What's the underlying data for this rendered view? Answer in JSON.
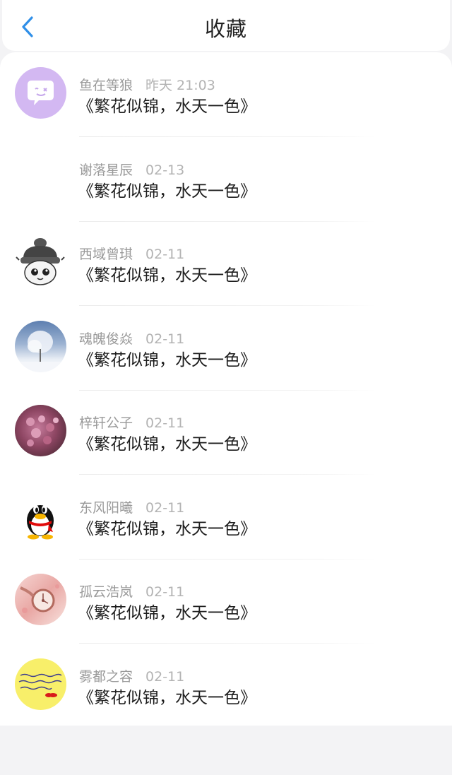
{
  "header": {
    "title": "收藏",
    "back_icon": "chevron-left-icon",
    "accent": "#2f8fe8"
  },
  "items": [
    {
      "name": "鱼在等狼",
      "time": "昨天 21:03",
      "content": "《繁花似锦，水天一色》",
      "avatar": "speech-bubble-avatar"
    },
    {
      "name": "谢落星辰",
      "time": "02-13",
      "content": "《繁花似锦，水天一色》",
      "avatar": "blank-avatar"
    },
    {
      "name": "西域曾琪",
      "time": "02-11",
      "content": "《繁花似锦，水天一色》",
      "avatar": "cartoon-penguin-hat-avatar"
    },
    {
      "name": "魂魄俊焱",
      "time": "02-11",
      "content": "《繁花似锦，水天一色》",
      "avatar": "snowy-tree-photo-avatar"
    },
    {
      "name": "梓轩公子",
      "time": "02-11",
      "content": "《繁花似锦，水天一色》",
      "avatar": "pink-flowers-photo-avatar"
    },
    {
      "name": "东风阳曦",
      "time": "02-11",
      "content": "《繁花似锦，水天一色》",
      "avatar": "qq-penguin-avatar"
    },
    {
      "name": "孤云浩岚",
      "time": "02-11",
      "content": "《繁花似锦，水天一色》",
      "avatar": "pink-watch-photo-avatar"
    },
    {
      "name": "雾都之容",
      "time": "02-11",
      "content": "《繁花似锦，水天一色》",
      "avatar": "yellow-handwriting-avatar"
    }
  ]
}
